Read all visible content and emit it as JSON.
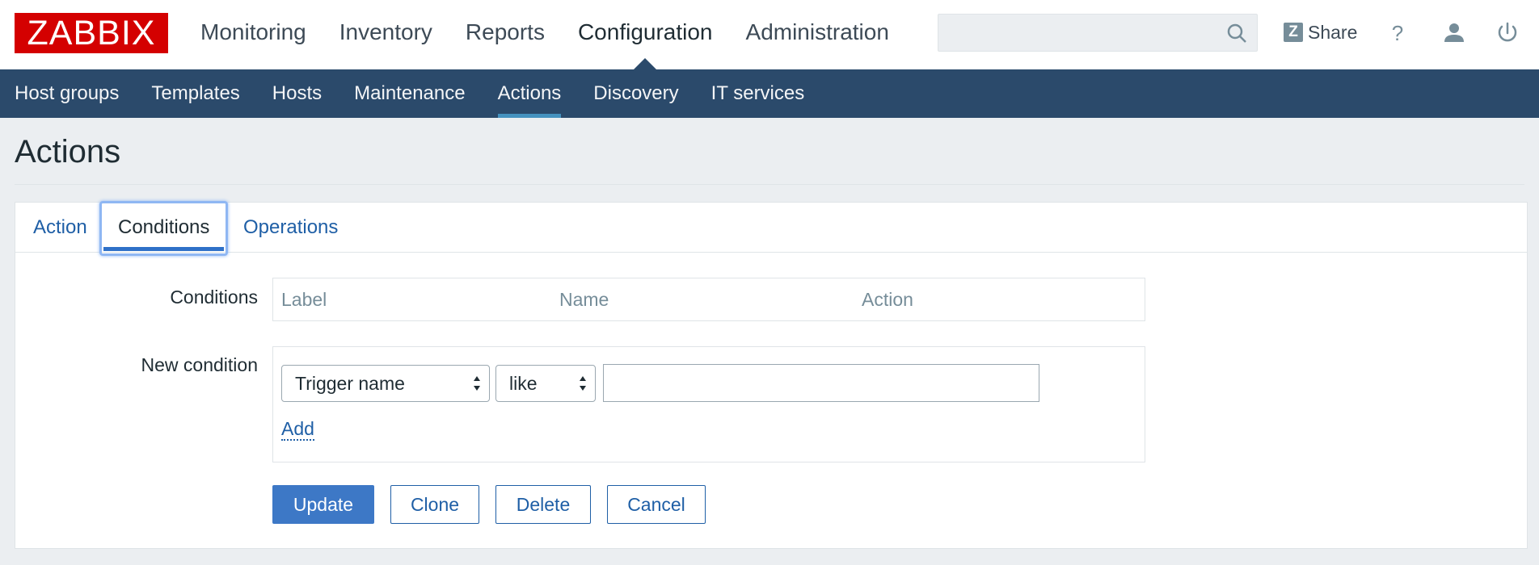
{
  "brand": {
    "logo_text": "ZABBIX",
    "color": "#d40000"
  },
  "top_nav": [
    {
      "label": "Monitoring",
      "active": false
    },
    {
      "label": "Inventory",
      "active": false
    },
    {
      "label": "Reports",
      "active": false
    },
    {
      "label": "Configuration",
      "active": true
    },
    {
      "label": "Administration",
      "active": false
    }
  ],
  "search": {
    "value": "",
    "placeholder": "",
    "icon": "search-icon"
  },
  "header_actions": {
    "share_label": "Share",
    "share_badge": "Z",
    "help_icon": "help-icon",
    "profile_icon": "user-icon",
    "logout_icon": "power-icon"
  },
  "sub_nav": [
    {
      "label": "Host groups"
    },
    {
      "label": "Templates"
    },
    {
      "label": "Hosts"
    },
    {
      "label": "Maintenance"
    },
    {
      "label": "Actions",
      "active": true
    },
    {
      "label": "Discovery"
    },
    {
      "label": "IT services"
    }
  ],
  "page": {
    "title": "Actions"
  },
  "tabs": [
    {
      "label": "Action",
      "active": false
    },
    {
      "label": "Conditions",
      "active": true
    },
    {
      "label": "Operations",
      "active": false
    }
  ],
  "conditions": {
    "label": "Conditions",
    "columns": [
      "Label",
      "Name",
      "Action"
    ]
  },
  "new_condition": {
    "label": "New condition",
    "type_select": "Trigger name",
    "operator_select": "like",
    "value": "",
    "add_label": "Add"
  },
  "buttons": {
    "update": "Update",
    "clone": "Clone",
    "delete": "Delete",
    "cancel": "Cancel"
  },
  "colors": {
    "nav_bg": "#2b4a6b",
    "link": "#1f5fa6",
    "primary_button": "#3d78c6",
    "active_tab_underline": "#2f70c8"
  }
}
